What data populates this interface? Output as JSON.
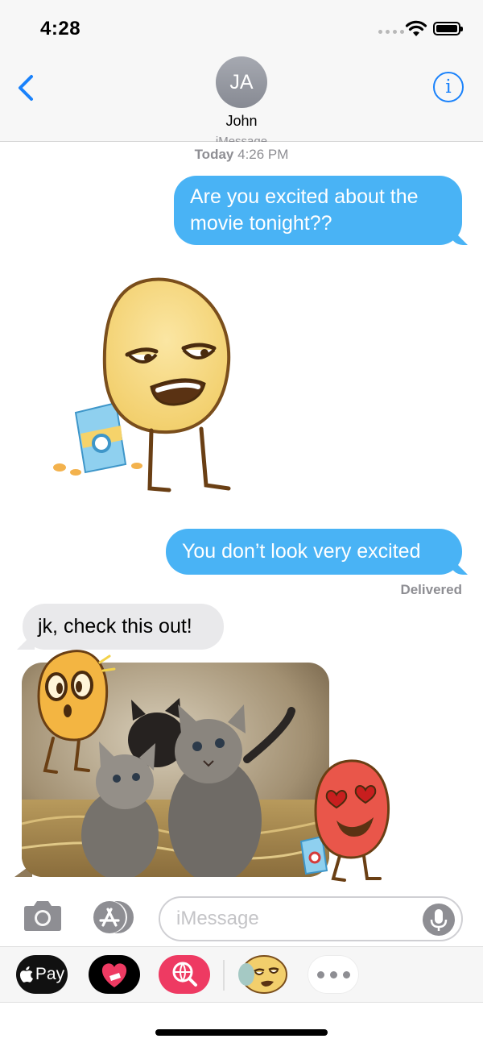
{
  "status_bar": {
    "time": "4:28"
  },
  "header": {
    "avatar_initials": "JA",
    "contact_name": "John"
  },
  "conversation": {
    "service": "iMessage",
    "timestamp_day": "Today",
    "timestamp_time": "4:26 PM",
    "messages": [
      {
        "direction": "outgoing",
        "text": "Are you excited about the movie tonight??"
      },
      {
        "direction": "outgoing",
        "text": "You don’t look very excited"
      },
      {
        "direction": "incoming",
        "text": "jk, check this out!"
      }
    ],
    "delivery_status": "Delivered"
  },
  "compose": {
    "placeholder": "iMessage"
  },
  "app_drawer": {
    "apple_pay_label": "Pay"
  },
  "colors": {
    "outgoing_bubble": "#49b3f5",
    "incoming_bubble": "#e9e9eb",
    "accent": "#1a82fb"
  }
}
